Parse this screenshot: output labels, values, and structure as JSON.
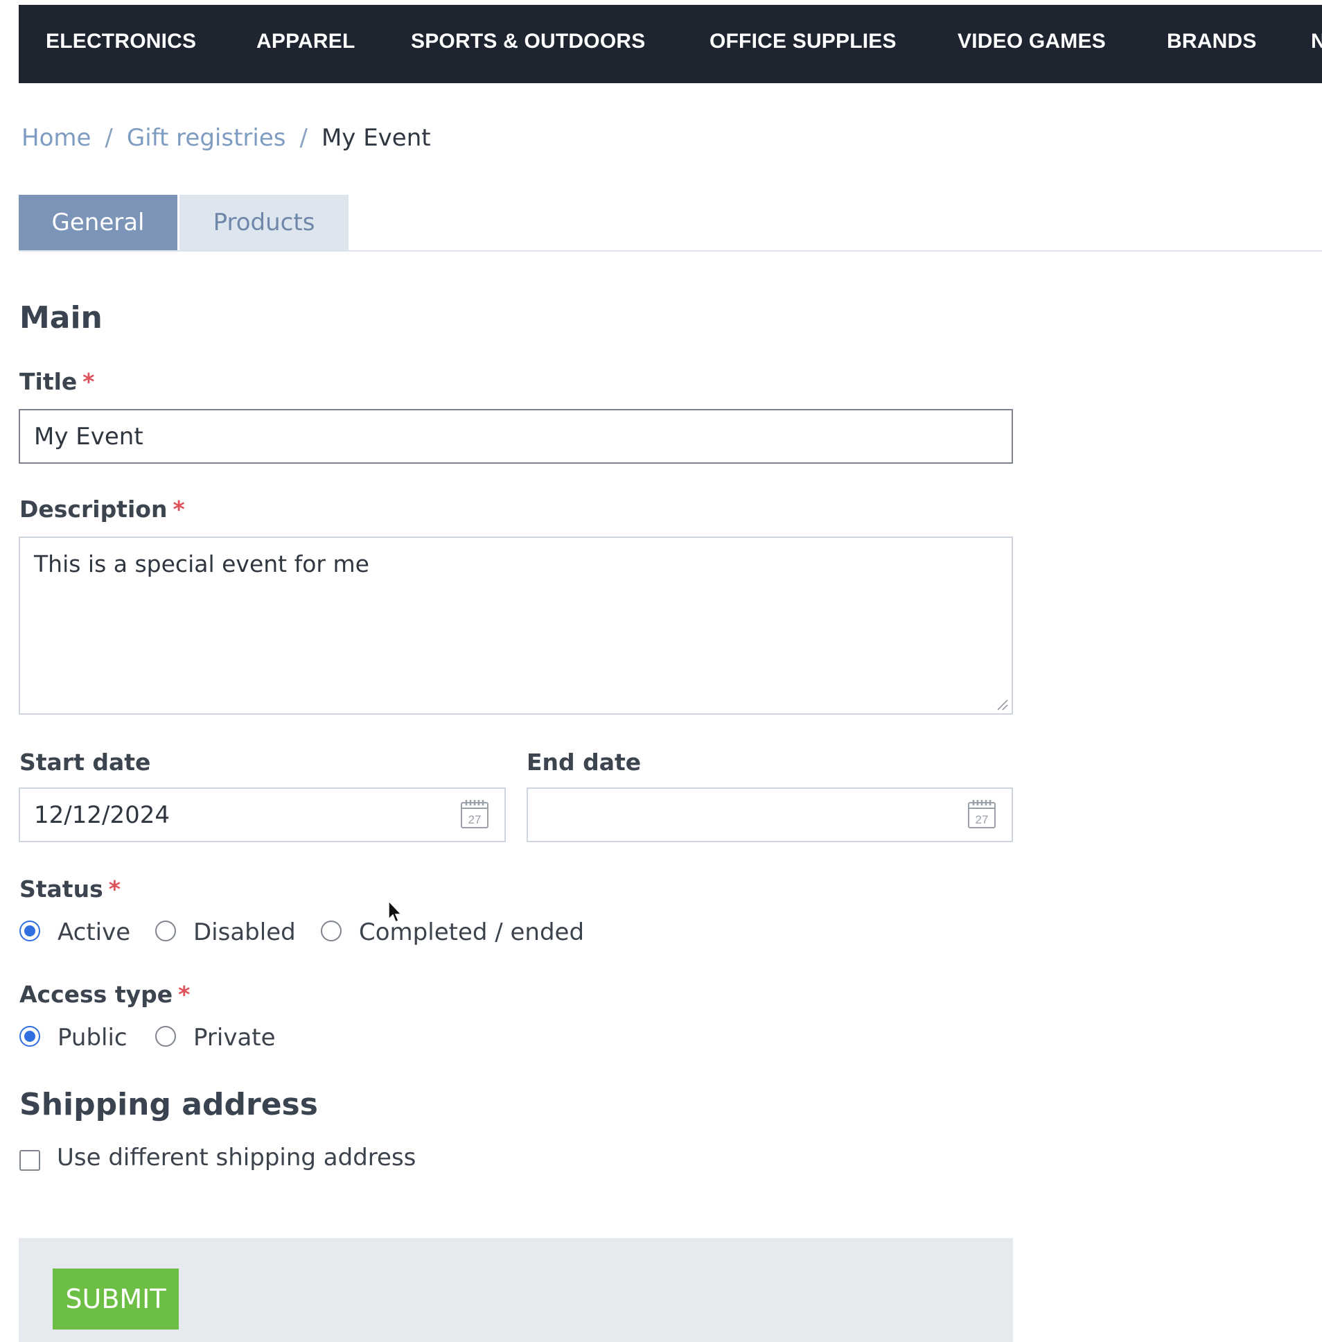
{
  "nav": {
    "items": [
      {
        "label": "ELECTRONICS"
      },
      {
        "label": "APPAREL"
      },
      {
        "label": "SPORTS & OUTDOORS"
      },
      {
        "label": "OFFICE SUPPLIES"
      },
      {
        "label": "VIDEO GAMES"
      },
      {
        "label": "BRANDS"
      },
      {
        "label": "N"
      }
    ]
  },
  "breadcrumb": {
    "home": "Home",
    "gift_registries": "Gift registries",
    "current": "My Event",
    "separator": "/"
  },
  "tabs": [
    {
      "label": "General",
      "active": true
    },
    {
      "label": "Products",
      "active": false
    }
  ],
  "main": {
    "heading": "Main",
    "title_label": "Title",
    "title_value": "My Event",
    "description_label": "Description",
    "description_value": "This is a special event for me",
    "start_date_label": "Start date",
    "start_date_value": "12/12/2024",
    "end_date_label": "End date",
    "end_date_value": "",
    "required_marker": "*",
    "status_label": "Status",
    "status_options": [
      {
        "label": "Active",
        "checked": true
      },
      {
        "label": "Disabled",
        "checked": false
      },
      {
        "label": "Completed / ended",
        "checked": false
      }
    ],
    "access_label": "Access type",
    "access_options": [
      {
        "label": "Public",
        "checked": true
      },
      {
        "label": "Private",
        "checked": false
      }
    ]
  },
  "shipping": {
    "heading": "Shipping address",
    "checkbox_label": "Use different shipping address",
    "checked": false
  },
  "actions": {
    "submit_label": "SUBMIT"
  },
  "icons": {
    "calendar": "calendar-icon",
    "cursor": "mouse-pointer-icon"
  },
  "colors": {
    "nav_bg": "#1e2530",
    "tab_active": "#7b94b7",
    "tab_inactive": "#dde5ef",
    "required": "#e0525b",
    "radio_checked": "#2f6fe0",
    "submit": "#6cbe45"
  }
}
